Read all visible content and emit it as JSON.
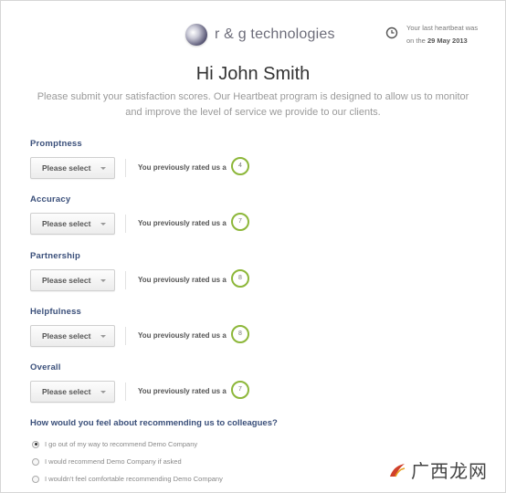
{
  "brand": {
    "name": "r & g technologies"
  },
  "heartbeat": {
    "line1": "Your last heartbeat was",
    "line2_prefix": "on the ",
    "line2_date": "29 May 2013"
  },
  "greeting": "Hi John Smith",
  "intro": "Please submit your satisfaction scores. Our Heartbeat program is designed to allow us to monitor and improve the level of service we provide to our clients.",
  "questions": [
    {
      "label": "Promptness",
      "select_value": "Please select",
      "prev_text": "You previously rated us a",
      "prev_score": "4"
    },
    {
      "label": "Accuracy",
      "select_value": "Please select",
      "prev_text": "You previously rated us a",
      "prev_score": "7"
    },
    {
      "label": "Partnership",
      "select_value": "Please select",
      "prev_text": "You previously rated us a",
      "prev_score": "8"
    },
    {
      "label": "Helpfulness",
      "select_value": "Please select",
      "prev_text": "You previously rated us a",
      "prev_score": "8"
    },
    {
      "label": "Overall",
      "select_value": "Please select",
      "prev_text": "You previously rated us a",
      "prev_score": "7"
    }
  ],
  "recommend": {
    "question": "How would you feel about recommending us to colleagues?",
    "options": [
      {
        "label": "I go out of my way to recommend Demo Company",
        "checked": true
      },
      {
        "label": "I would recommend Demo Company if asked",
        "checked": false
      },
      {
        "label": "I wouldn't feel comfortable recommending Demo Company",
        "checked": false
      }
    ]
  },
  "watermark": "广西龙网",
  "colors": {
    "score_ring": "#8db73a",
    "label_blue": "#3a4f7a"
  }
}
